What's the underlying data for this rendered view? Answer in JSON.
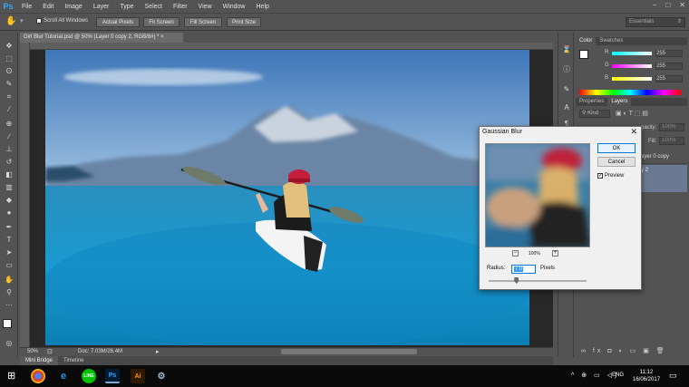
{
  "app": {
    "logo": "Ps",
    "menu": [
      "File",
      "Edit",
      "Image",
      "Layer",
      "Type",
      "Select",
      "Filter",
      "View",
      "Window",
      "Help"
    ],
    "window_controls": [
      "−",
      "□",
      "✕"
    ]
  },
  "options_bar": {
    "scroll_all_windows": "Scroll All Windows",
    "actual_pixels": "Actual Pixels",
    "fit_screen": "Fit Screen",
    "fill_screen": "Fill Screen",
    "print_size": "Print Size",
    "workspace": "Essentials"
  },
  "document": {
    "tab_title": "Girl Blur Tutorial.psd @ 50% (Layer 0 copy 2, RGB/8#) * ×",
    "zoom": "50%",
    "doc_info": "Doc: 7.03M/26.4M"
  },
  "bottom_tabs": [
    "Mini Bridge",
    "Timeline"
  ],
  "color_panel": {
    "tabs": [
      "Color",
      "Swatches"
    ],
    "channels": [
      {
        "label": "R",
        "value": "255",
        "color_a": "#00ffff",
        "color_b": "#ffffff"
      },
      {
        "label": "G",
        "value": "255",
        "color_a": "#ff00ff",
        "color_b": "#ffffff"
      },
      {
        "label": "B",
        "value": "255",
        "color_a": "#ffff00",
        "color_b": "#ffffff"
      }
    ]
  },
  "layers_panel": {
    "tabs": [
      "Properties",
      "Layers"
    ],
    "kind": "Kind",
    "opacity_label": "pacity:",
    "opacity_value": "100%",
    "fill_label": "Fill:",
    "fill_value": "100%",
    "layer_rows": [
      "ayer 0 copy",
      "y 2"
    ]
  },
  "dialog": {
    "title": "Gaussian Blur",
    "ok": "OK",
    "cancel": "Cancel",
    "preview_label": "Preview",
    "preview_checked": true,
    "zoom_percent": "100%",
    "radius_label": "Radius:",
    "radius_value": "7.0",
    "radius_unit": "Pixels",
    "radius_slider_fraction": 0.28
  },
  "taskbar": {
    "apps": [
      "chrome",
      "edge",
      "line",
      "Ps",
      "Ai",
      "steam"
    ],
    "language": "ENG",
    "time": "11:12",
    "date": "16/06/2017"
  }
}
